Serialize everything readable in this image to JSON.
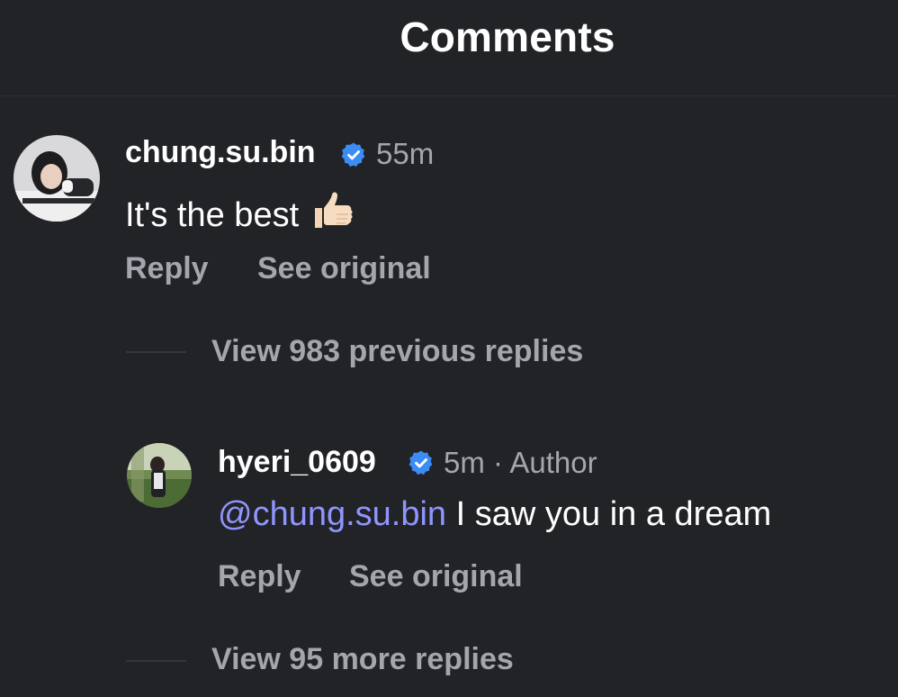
{
  "header": {
    "title": "Comments"
  },
  "comments": [
    {
      "username": "chung.su.bin",
      "verified": true,
      "time": "55m",
      "text": "It's the best",
      "emoji": "thumbs-up-icon",
      "reply_label": "Reply",
      "see_original_label": "See original",
      "view_replies_label": "View 983 previous replies",
      "replies": [
        {
          "username": "hyeri_0609",
          "verified": true,
          "meta": "5m · Author",
          "mention": "@chung.su.bin",
          "text": " I saw you in a dream",
          "reply_label": "Reply",
          "see_original_label": "See original",
          "view_more_label": "View 95 more replies"
        }
      ]
    }
  ],
  "colors": {
    "background": "#222327",
    "muted_text": "#a3a6ad",
    "mention": "#8f95ff",
    "verified_badge": "#3b8cf5"
  }
}
